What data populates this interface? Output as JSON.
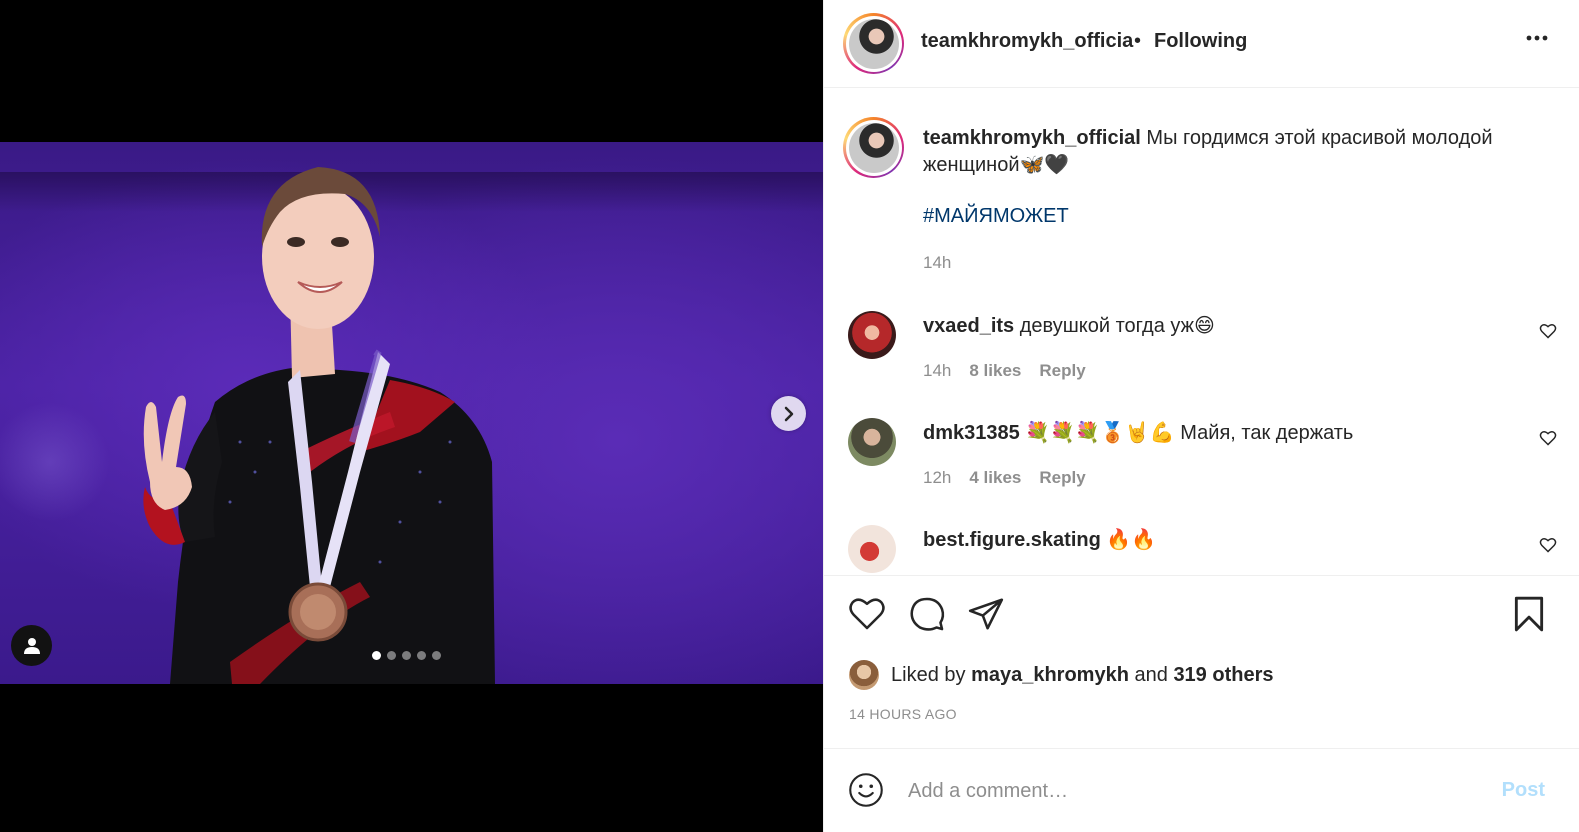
{
  "post": {
    "username_header": "teamkhromykh_officia",
    "bullet": "•",
    "follow_status": "Following",
    "more_icon": "more-horizontal-icon"
  },
  "media": {
    "photo_description_icon": "photo",
    "carousel_total": 5,
    "carousel_active": 1
  },
  "caption": {
    "username": "teamkhromykh_official",
    "text": "Мы гордимся этой красивой молодой женщиной🦋🖤",
    "hashtag": "#МАЙЯМОЖЕТ",
    "time": "14h"
  },
  "comments": [
    {
      "username": "vxaed_its",
      "text": "девушкой тогда уж😄",
      "time": "14h",
      "likes": "8 likes",
      "reply": "Reply"
    },
    {
      "username": "dmk31385",
      "text": "💐💐💐🥉🤘💪 Майя, так держать",
      "time": "12h",
      "likes": "4 likes",
      "reply": "Reply"
    },
    {
      "username": "best.figure.skating",
      "text": "🔥🔥"
    }
  ],
  "likes": {
    "prefix": "Liked by",
    "user": "maya_khromykh",
    "and": "and",
    "others": "319 others"
  },
  "posted": "14 HOURS AGO",
  "add_comment": {
    "placeholder": "Add a comment…",
    "post_label": "Post"
  },
  "colors": {
    "link": "#00376b",
    "post_disabled": "#b2dffc",
    "muted": "#8e8e8e",
    "text": "#262626"
  }
}
